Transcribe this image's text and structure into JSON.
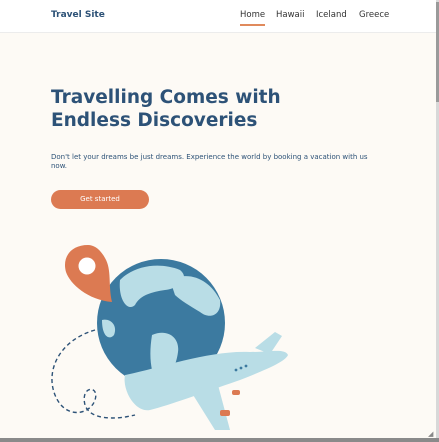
{
  "nav": {
    "logo": "Travel Site",
    "links": [
      "Home",
      "Hawaii",
      "Iceland",
      "Greece"
    ],
    "active": "Home"
  },
  "hero": {
    "title_line1": "Travelling Comes with",
    "title_line2": "Endless Discoveries",
    "subtitle": "Don't let your dreams be just dreams. Experience the world by booking a vacation with us now.",
    "cta_label": "Get started"
  },
  "colors": {
    "primary": "#2d5277",
    "accent": "#dc7a52",
    "background": "#fdfaf5"
  },
  "illustration": {
    "icons": [
      "map-pin-icon",
      "globe-icon",
      "airplane-icon"
    ]
  }
}
